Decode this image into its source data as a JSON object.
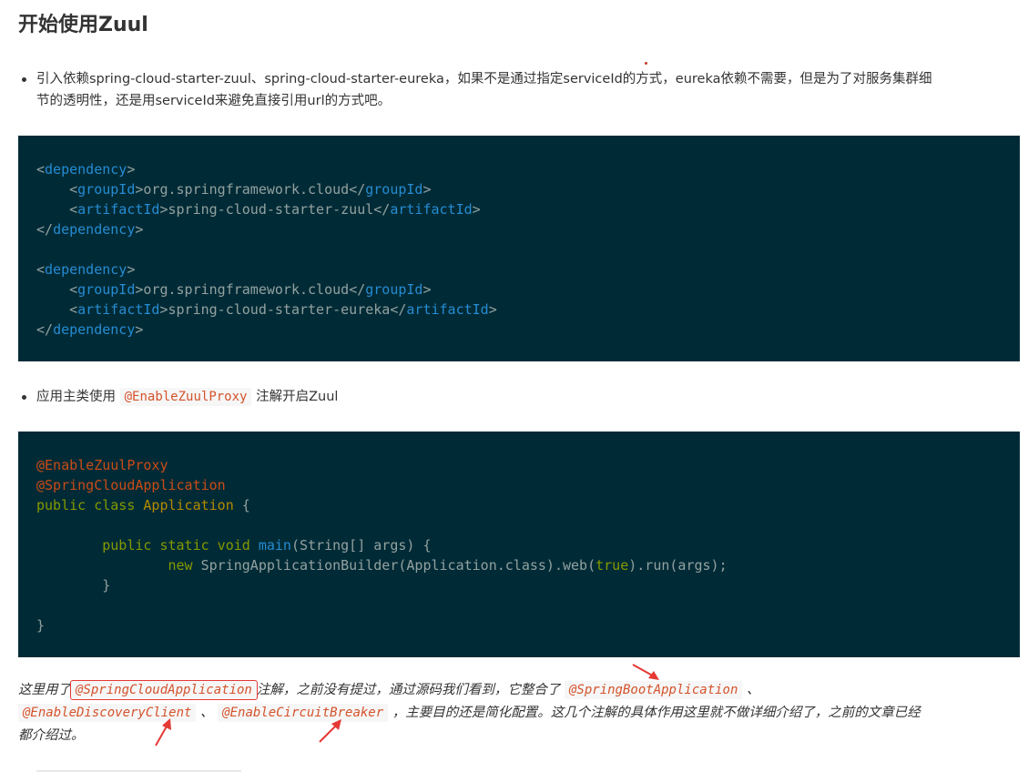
{
  "heading": "开始使用Zuul",
  "bullet1": {
    "text_line1": "引入依赖spring-cloud-starter-zuul、spring-cloud-starter-eureka，如果不是通过指定serviceId的方式，eureka依赖不需要，但是为了对服务集群细",
    "text_line2": "节的透明性，还是用serviceId来避免直接引用url的方式吧。"
  },
  "xml_block": {
    "dep1_open": "dependency",
    "dep1_group_tag": "groupId",
    "dep1_group_value": "org.springframework.cloud",
    "dep1_artifact_tag": "artifactId",
    "dep1_artifact_value": "spring-cloud-starter-zuul",
    "dep2_open": "dependency",
    "dep2_group_tag": "groupId",
    "dep2_group_value": "org.springframework.cloud",
    "dep2_artifact_tag": "artifactId",
    "dep2_artifact_value": "spring-cloud-starter-eureka"
  },
  "bullet2": {
    "prefix": "应用主类使用",
    "code": "@EnableZuulProxy",
    "suffix": "注解开启Zuul"
  },
  "java_block": {
    "anno1": "@EnableZuulProxy",
    "anno2": "@SpringCloudApplication",
    "class_kw": "public class",
    "class_name": "Application",
    "method_kw": "public static void",
    "method_name": "main",
    "method_params": "(String[] args) {",
    "new_kw": "new",
    "builder_call": "SpringApplicationBuilder(Application.class).web(",
    "true_lit": "true",
    "run_call": ").run(args);",
    "inner_close": "}",
    "outer_close": "}",
    "class_open": " {"
  },
  "note": {
    "part1": "这里用了",
    "code1": "@SpringCloudApplication",
    "part2": "注解，之前没有提过，通过源码我们看到，它整合了",
    "code2": "@SpringBootApplication",
    "part3": "、",
    "code3": "@EnableDiscoveryClient",
    "part4": "、",
    "code4": "@EnableCircuitBreaker",
    "part5": "，主要目的还是简化配置。这几个注解的具体作用这里就不做详细介绍了，之前的文章已经",
    "part6": "都介绍过。"
  },
  "colors": {
    "code_bg": "#002b36",
    "tag": "#268bd2",
    "annotation": "#cb4b16",
    "keyword": "#859900",
    "class_name": "#b58900",
    "inline_code": "#d4532c",
    "highlight_box": "#e53935",
    "arrow": "#e53935"
  }
}
